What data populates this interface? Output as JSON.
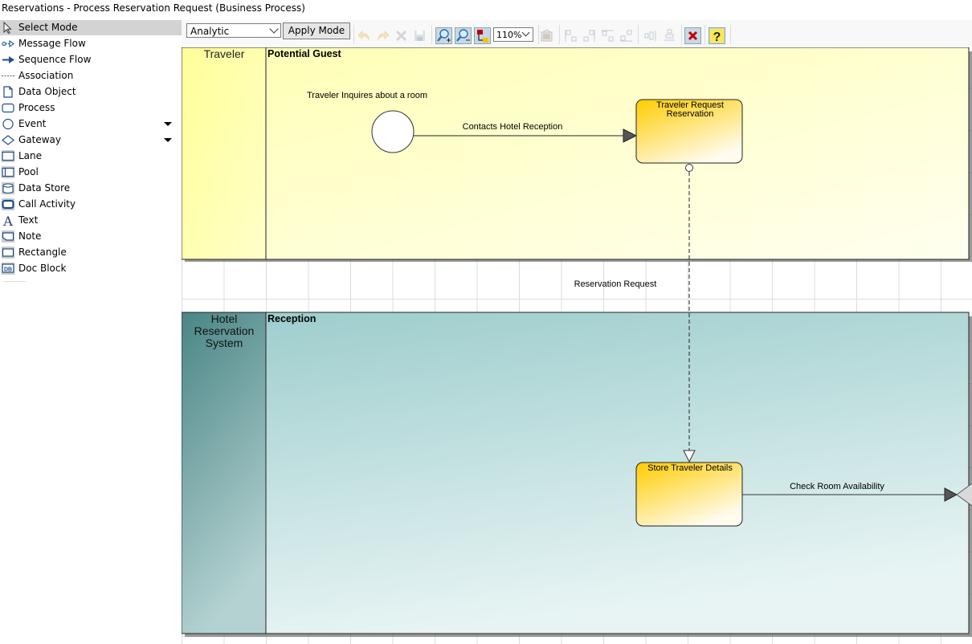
{
  "window": {
    "title": "Reservations - Process Reservation Request (Business Process)"
  },
  "palette": {
    "items": [
      {
        "label": "Select Mode",
        "icon": "pointer-icon",
        "selected": true
      },
      {
        "label": "Message Flow",
        "icon": "message-flow-icon"
      },
      {
        "label": "Sequence Flow",
        "icon": "sequence-flow-icon"
      },
      {
        "label": "Association",
        "icon": "association-icon"
      },
      {
        "label": "Data Object",
        "icon": "data-object-icon"
      },
      {
        "label": "Process",
        "icon": "process-icon"
      },
      {
        "label": "Event",
        "icon": "event-icon",
        "has_dropdown": true
      },
      {
        "label": "Gateway",
        "icon": "gateway-icon",
        "has_dropdown": true
      },
      {
        "label": "Lane",
        "icon": "lane-icon"
      },
      {
        "label": "Pool",
        "icon": "pool-icon"
      },
      {
        "label": "Data Store",
        "icon": "data-store-icon"
      },
      {
        "label": "Call Activity",
        "icon": "call-activity-icon"
      },
      {
        "label": "Text",
        "icon": "text-icon"
      },
      {
        "label": "Note",
        "icon": "note-icon"
      },
      {
        "label": "Rectangle",
        "icon": "rectangle-icon"
      },
      {
        "label": "Doc Block",
        "icon": "doc-block-icon"
      }
    ]
  },
  "toolbar": {
    "mode_value": "Analytic",
    "apply_label": "Apply Mode",
    "zoom_value": "110%",
    "buttons": [
      {
        "name": "undo-icon",
        "enabled": false
      },
      {
        "name": "redo-icon",
        "enabled": false
      },
      {
        "name": "delete-icon",
        "enabled": false
      },
      {
        "name": "save-icon",
        "enabled": false
      },
      {
        "name": "zoom-in-icon",
        "enabled": true
      },
      {
        "name": "zoom-out-icon",
        "enabled": true
      },
      {
        "name": "toggle-tree-icon",
        "enabled": true
      },
      {
        "name": "export-image-icon",
        "enabled": false
      },
      {
        "name": "align-left-icon",
        "enabled": false
      },
      {
        "name": "align-right-icon",
        "enabled": false
      },
      {
        "name": "align-top-icon",
        "enabled": false
      },
      {
        "name": "align-bottom-icon",
        "enabled": false
      },
      {
        "name": "distribute-horizontal-icon",
        "enabled": false
      },
      {
        "name": "distribute-vertical-icon",
        "enabled": false
      },
      {
        "name": "close-icon",
        "enabled": true
      },
      {
        "name": "help-icon",
        "enabled": true
      }
    ]
  },
  "diagram": {
    "pools": [
      {
        "name": "Traveler",
        "lane": "Potential Guest",
        "colors": {
          "header": "#ffff99",
          "body_top": "#ffffb3",
          "body_bottom": "#fffff0"
        }
      },
      {
        "name": "Hotel Reservation System",
        "lane": "Reception",
        "colors": {
          "header": "#4a8585",
          "body_top": "#9ccccc",
          "body_bottom": "#e8f4f4"
        }
      }
    ],
    "start_event": {
      "label": "Traveler Inquires about a room"
    },
    "tasks": [
      {
        "id": "t1",
        "label_lines": [
          "Traveler Request",
          "Reservation"
        ]
      },
      {
        "id": "t2",
        "label_lines": [
          "Store Traveler Details"
        ]
      }
    ],
    "flows": [
      {
        "type": "sequence",
        "label": "Contacts Hotel Reception"
      },
      {
        "type": "message",
        "label": "Reservation Request"
      },
      {
        "type": "sequence",
        "label": "Check Room Availability"
      }
    ],
    "task_color_top": "#ffcc00",
    "task_color_bottom": "#fffbee"
  }
}
